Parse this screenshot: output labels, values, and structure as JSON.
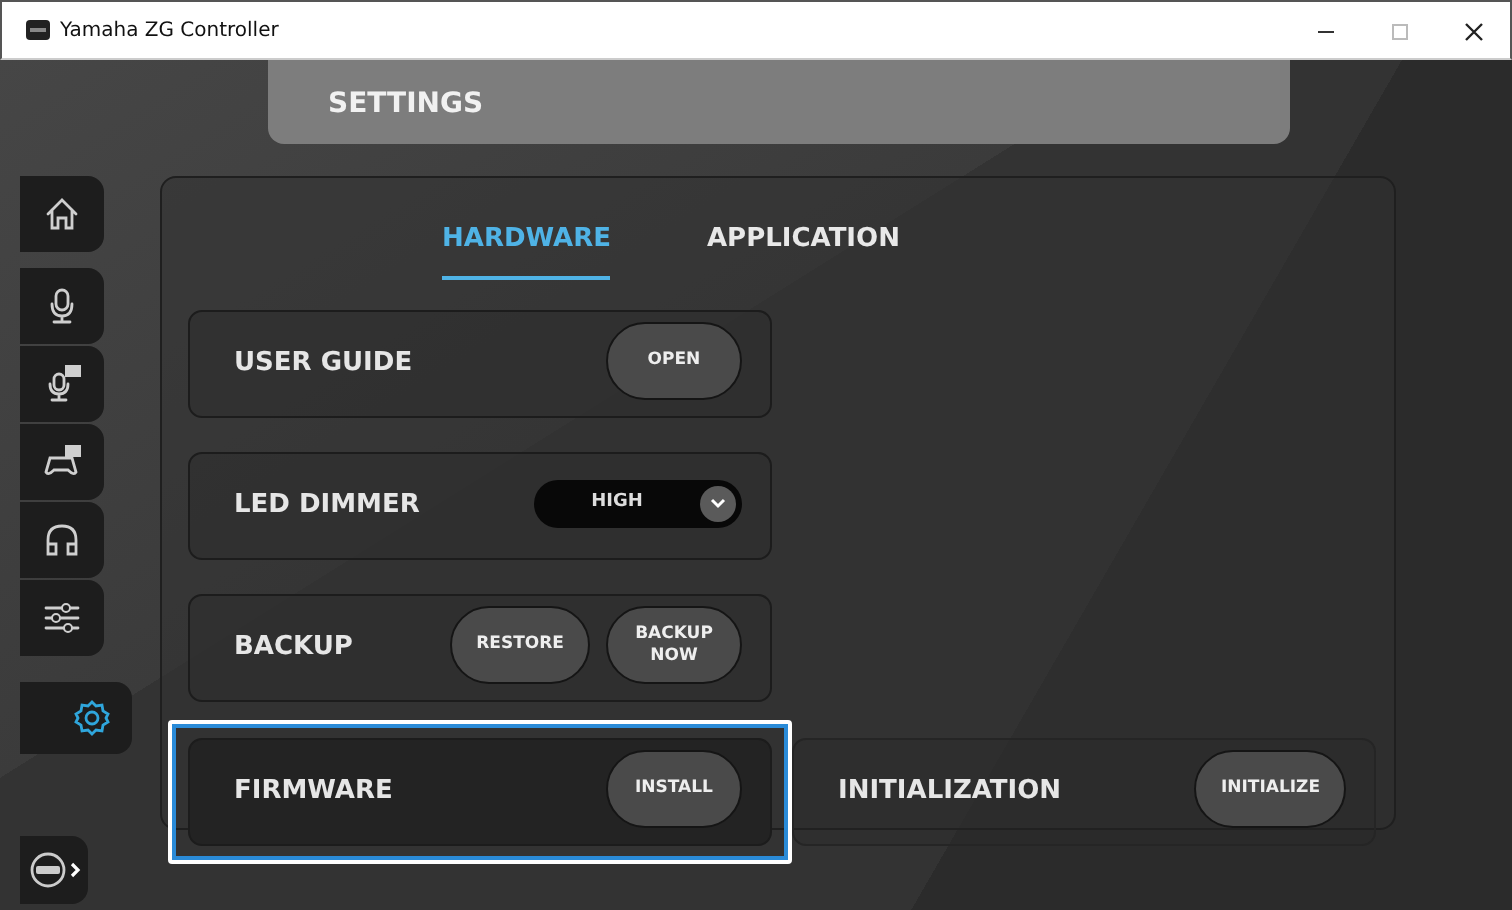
{
  "window": {
    "title": "Yamaha ZG Controller"
  },
  "header": {
    "title": "SETTINGS"
  },
  "sidebar": {
    "items": [
      {
        "kind": "home",
        "selected": false
      },
      {
        "kind": "mic",
        "selected": false
      },
      {
        "kind": "mic-fx",
        "selected": false
      },
      {
        "kind": "game-fx",
        "selected": false
      },
      {
        "kind": "headphones",
        "selected": false
      },
      {
        "kind": "mixer",
        "selected": false
      },
      {
        "kind": "settings",
        "selected": true
      }
    ],
    "device_switch": {
      "kind": "controller"
    }
  },
  "tabs": [
    {
      "label": "HARDWARE",
      "selected": true
    },
    {
      "label": "APPLICATION",
      "selected": false
    }
  ],
  "settings": [
    {
      "label": "USER GUIDE",
      "focused": false,
      "controls": [
        {
          "kind": "button",
          "label": "OPEN"
        }
      ]
    },
    {
      "label": "LED DIMMER",
      "focused": false,
      "controls": [
        {
          "kind": "dropdown",
          "label": "HIGH"
        }
      ]
    },
    {
      "label": "BACKUP",
      "focused": false,
      "controls": [
        {
          "kind": "button",
          "label": "RESTORE"
        },
        {
          "kind": "button",
          "label": "BACKUP NOW"
        }
      ]
    },
    {
      "label": "FIRMWARE",
      "focused": true,
      "controls": [
        {
          "kind": "button",
          "label": "INSTALL"
        }
      ]
    },
    {
      "label": "INITIALIZATION",
      "focused": false,
      "controls": [
        {
          "kind": "button",
          "label": "INITIALIZE"
        }
      ]
    }
  ]
}
